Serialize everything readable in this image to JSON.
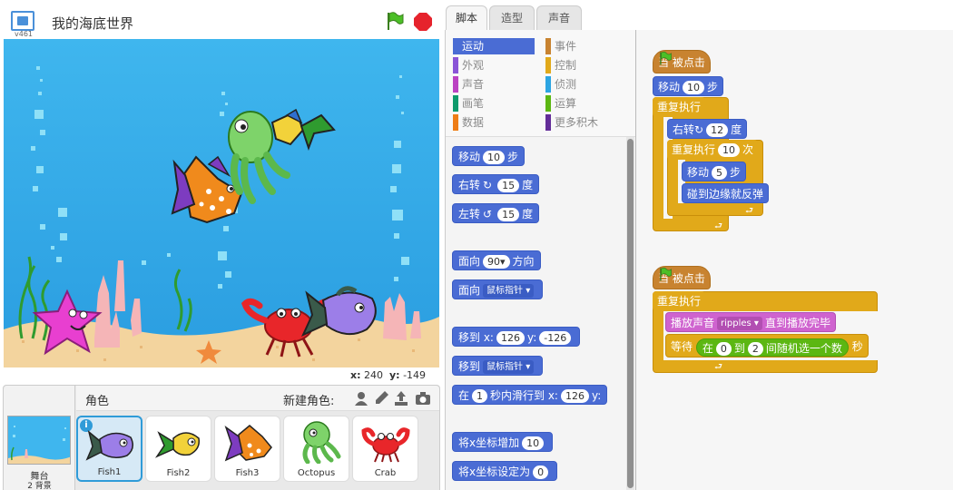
{
  "stage_header": {
    "version": "v461",
    "project_title": "我的海底世界"
  },
  "stage": {
    "mouse_x_label": "x:",
    "mouse_x": "240",
    "mouse_y_label": "y:",
    "mouse_y": "-149"
  },
  "sprites_panel": {
    "title": "角色",
    "new_sprite_label": "新建角色:",
    "stage_label": "舞台",
    "backdrop_count": "2 背景",
    "sprites": [
      {
        "name": "Fish1",
        "selected": true,
        "color": "#9c7ee8"
      },
      {
        "name": "Fish2",
        "selected": false,
        "color": "#f2d23a"
      },
      {
        "name": "Fish3",
        "selected": false,
        "color": "#ff8c1a"
      },
      {
        "name": "Octopus",
        "selected": false,
        "color": "#7ed36a"
      },
      {
        "name": "Crab",
        "selected": false,
        "color": "#e8262a"
      }
    ],
    "icons": [
      "sprite-library-icon",
      "paint-brush-icon",
      "upload-icon",
      "camera-icon"
    ]
  },
  "tabs": [
    {
      "label": "脚本",
      "active": true
    },
    {
      "label": "造型",
      "active": false
    },
    {
      "label": "声音",
      "active": false
    }
  ],
  "categories": {
    "left": [
      {
        "label": "运动",
        "color": "#4a6cd4",
        "active": true
      },
      {
        "label": "外观",
        "color": "#8a55d7"
      },
      {
        "label": "声音",
        "color": "#bb42c3"
      },
      {
        "label": "画笔",
        "color": "#0e9a6c"
      },
      {
        "label": "数据",
        "color": "#ee7d16"
      }
    ],
    "right": [
      {
        "label": "事件",
        "color": "#c88330"
      },
      {
        "label": "控制",
        "color": "#e1a91a"
      },
      {
        "label": "侦测",
        "color": "#2ca5e2"
      },
      {
        "label": "运算",
        "color": "#5cb712"
      },
      {
        "label": "更多积木",
        "color": "#632d99"
      }
    ]
  },
  "palette_blocks": {
    "move": {
      "text": "移动",
      "value": "10",
      "suffix": "步"
    },
    "turn_right": {
      "text": "右转",
      "value": "15",
      "suffix": "度"
    },
    "turn_left": {
      "text": "左转",
      "value": "15",
      "suffix": "度"
    },
    "point_dir": {
      "text": "面向",
      "value": "90▾",
      "suffix": "方向"
    },
    "point_towards": {
      "text": "面向",
      "dropdown": "鼠标指针"
    },
    "goto_xy": {
      "text": "移到 x:",
      "x": "126",
      "y_label": "y:",
      "y": "-126"
    },
    "goto": {
      "text": "移到",
      "dropdown": "鼠标指针"
    },
    "glide": {
      "text": "在",
      "secs": "1",
      "mid": "秒内滑行到 x:",
      "x": "126",
      "y_label": "y:"
    },
    "change_x": {
      "text": "将x坐标增加",
      "value": "10"
    },
    "set_x": {
      "text": "将x坐标设定为",
      "value": "0"
    }
  },
  "scripts": {
    "script1": {
      "hat": {
        "prefix": "当",
        "suffix": "被点击"
      },
      "move": {
        "text": "移动",
        "value": "10",
        "suffix": "步"
      },
      "forever": "重复执行",
      "turn": {
        "text": "右转",
        "value": "12",
        "suffix": "度"
      },
      "repeat": {
        "text": "重复执行",
        "value": "10",
        "suffix": "次"
      },
      "inner_move": {
        "text": "移动",
        "value": "5",
        "suffix": "步"
      },
      "bounce": "碰到边缘就反弹"
    },
    "script2": {
      "hat": {
        "prefix": "当",
        "suffix": "被点击"
      },
      "forever": "重复执行",
      "play_sound": {
        "text": "播放声音",
        "sound": "ripples",
        "suffix": "直到播放完毕"
      },
      "wait": {
        "text": "等待",
        "op_prefix": "在",
        "from": "0",
        "op_mid": "到",
        "to": "2",
        "op_suffix": "间随机选一个数",
        "suffix": "秒"
      }
    }
  }
}
